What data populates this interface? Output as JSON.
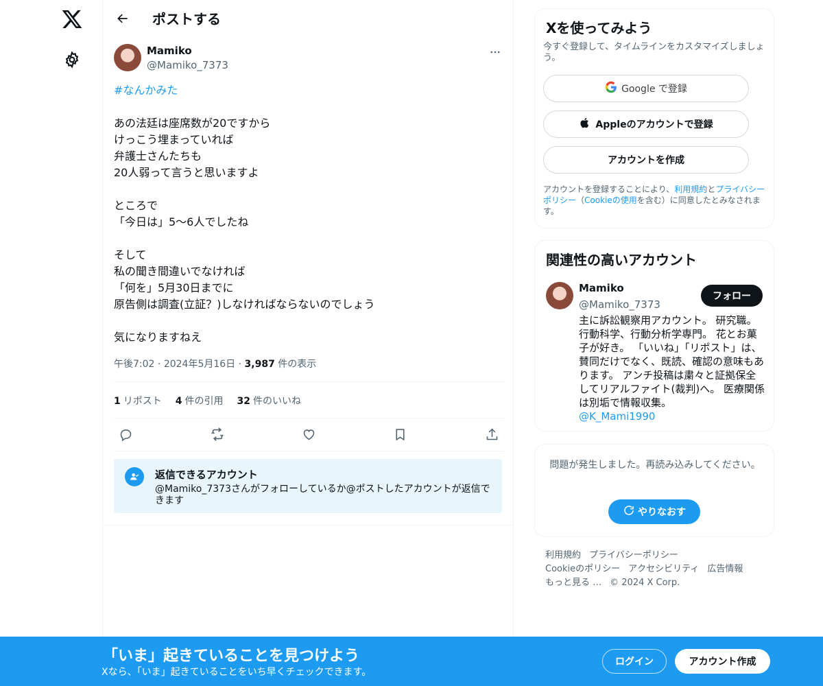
{
  "header": {
    "title": "ポストする"
  },
  "post": {
    "author_name": "Mamiko",
    "author_handle": "@Mamiko_7373",
    "hashtag": "#なんかみた",
    "body": "あの法廷は座席数が20ですから\nけっこう埋まっていれば\n弁護士さんたちも\n20人弱って言うと思いますよ\n\nところで\n「今日は」5〜6人でしたね\n\nそして\n私の聞き間違いでなければ\n「何を」5月30日までに\n原告側は調査(立証？)しなければならないのでしょう\n\n気になりますねえ",
    "time": "午後7:02",
    "date": "2024年5月16日",
    "views_count": "3,987",
    "views_label": "件の表示",
    "reposts_count": "1",
    "reposts_label": "リポスト",
    "quotes_count": "4",
    "quotes_label": "件の引用",
    "likes_count": "32",
    "likes_label": "件のいいね"
  },
  "reply_restriction": {
    "title": "返信できるアカウント",
    "text": "@Mamiko_7373さんがフォローしているか@ポストしたアカウントが返信できます"
  },
  "signup_card": {
    "title": "Xを使ってみよう",
    "subtitle": "今すぐ登録して、タイムラインをカスタマイズしましょう。",
    "google_label": "Google で登録",
    "apple_label": "Appleのアカウントで登録",
    "create_label": "アカウントを作成",
    "legal_prefix": "アカウントを登録することにより、",
    "terms_link": "利用規約",
    "legal_and": "と",
    "privacy_link": "プライバシーポリシー",
    "legal_paren_open": "（",
    "cookie_link": "Cookieの使用",
    "legal_suffix": "を含む）に同意したとみなされます。"
  },
  "relevant_card": {
    "title": "関連性の高いアカウント",
    "name": "Mamiko",
    "handle": "@Mamiko_7373",
    "follow_label": "フォロー",
    "bio": "主に訴訟観察用アカウント。 研究職。行動科学、行動分析学専門。 花とお菓子が好き。 「いいね」「リポスト」は、賛同だけでなく、既読、確認の意味もあります。 アンチ投稿は粛々と証拠保全してリアルファイト(裁判)へ。 医療関係は別垢で情報収集。",
    "bio_link": "@K_Mami1990"
  },
  "error_card": {
    "message": "問題が発生しました。再読み込みしてください。",
    "retry_label": "やりなおす"
  },
  "footer": {
    "links": [
      "利用規約",
      "プライバシーポリシー",
      "Cookieのポリシー",
      "アクセシビリティ",
      "広告情報",
      "もっと見る …"
    ],
    "copyright": "© 2024 X Corp."
  },
  "banner": {
    "title": "「いま」起きていることを見つけよう",
    "subtitle": "Xなら、「いま」起きていることをいち早くチェックできます。",
    "login_label": "ログイン",
    "signup_label": "アカウント作成"
  },
  "colors": {
    "accent": "#1d9bf0",
    "text": "#0f1419",
    "muted": "#536471"
  },
  "icons": [
    "x-logo-icon",
    "gear-icon",
    "back-arrow-icon",
    "more-icon",
    "reply-icon",
    "repost-icon",
    "like-icon",
    "bookmark-icon",
    "share-icon",
    "google-icon",
    "apple-icon",
    "mention-icon",
    "refresh-icon"
  ]
}
